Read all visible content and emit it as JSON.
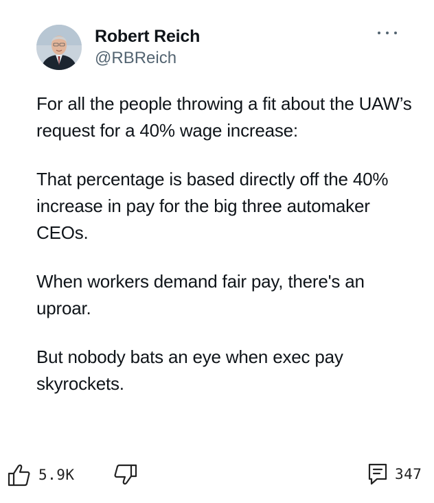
{
  "author": {
    "display_name": "Robert Reich",
    "handle": "@RBReich"
  },
  "tweet": {
    "paragraphs": [
      "For all the people throwing a fit about the UAW’s request for a 40% wage increase:",
      "That percentage is based directly off the 40% increase in pay for the big three automaker CEOs.",
      "When workers demand fair pay, there's an uproar.",
      "But nobody bats an eye when exec pay skyrockets."
    ]
  },
  "actions": {
    "upvote_count": "5.9K",
    "comment_count": "347"
  },
  "icons": {
    "more": "more-horizontal-icon",
    "upvote": "thumbs-up-icon",
    "downvote": "thumbs-down-icon",
    "comment": "comment-icon"
  }
}
